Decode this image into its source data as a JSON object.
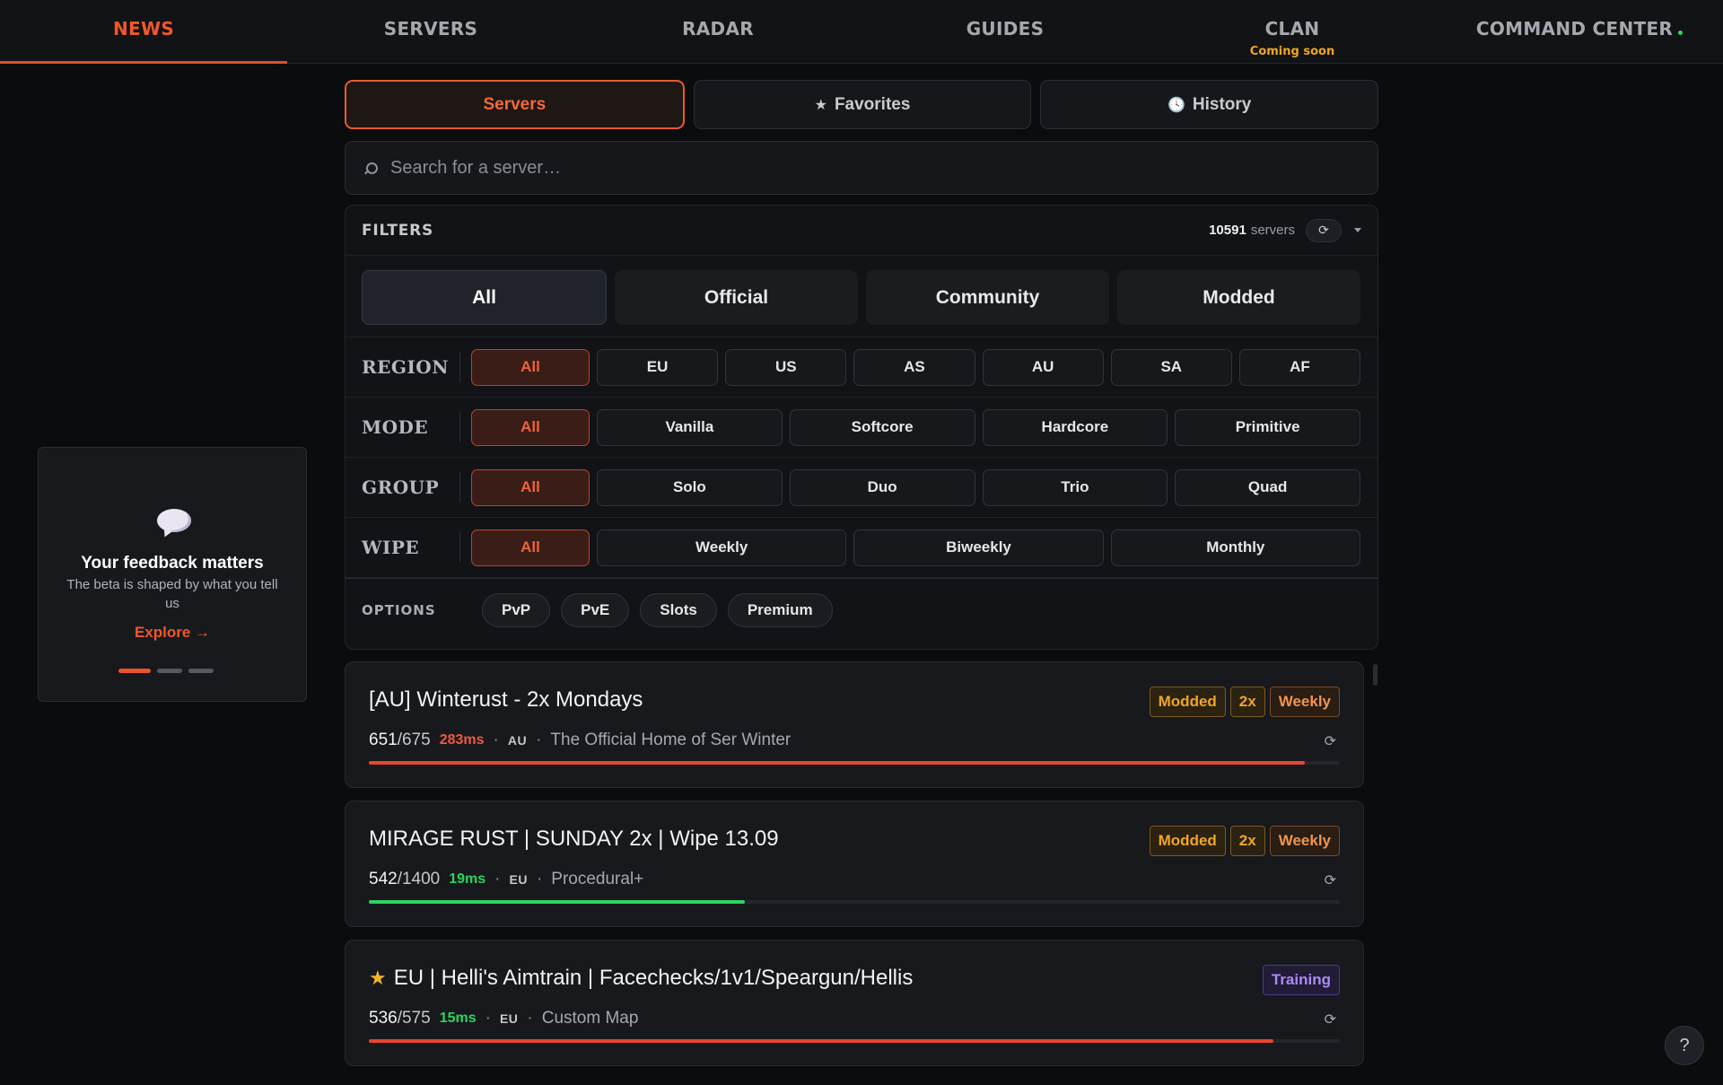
{
  "nav": {
    "items": [
      {
        "label": "NEWS",
        "sub": ""
      },
      {
        "label": "SERVERS",
        "sub": ""
      },
      {
        "label": "RADAR",
        "sub": ""
      },
      {
        "label": "GUIDES",
        "sub": ""
      },
      {
        "label": "CLAN",
        "sub": "Coming soon"
      },
      {
        "label": "COMMAND CENTER",
        "sub": ""
      }
    ],
    "active_index": 1,
    "accent_color": "#f2562b",
    "live_dot_color": "#2dd45e"
  },
  "tabs": [
    {
      "label": "Servers",
      "icon": ""
    },
    {
      "label": "Favorites",
      "icon": "star-icon"
    },
    {
      "label": "History",
      "icon": "clock-icon"
    }
  ],
  "search": {
    "placeholder": "Search for a server…",
    "value": ""
  },
  "filters": {
    "title": "FILTERS",
    "count": "10591",
    "count_unit": "servers",
    "types": [
      "All",
      "Official",
      "Community",
      "Modded"
    ],
    "rows": [
      {
        "label": "REGION",
        "options": [
          "All",
          "EU",
          "US",
          "AS",
          "AU",
          "SA",
          "AF"
        ]
      },
      {
        "label": "MODE",
        "options": [
          "All",
          "Vanilla",
          "Softcore",
          "Hardcore",
          "Primitive"
        ]
      },
      {
        "label": "GROUP",
        "options": [
          "All",
          "Solo",
          "Duo",
          "Trio",
          "Quad"
        ]
      },
      {
        "label": "WIPE",
        "options": [
          "All",
          "Weekly",
          "Biweekly",
          "Monthly"
        ]
      }
    ],
    "options_label": "OPTIONS",
    "options": [
      "PvP",
      "PvE",
      "Slots",
      "Premium"
    ]
  },
  "servers": [
    {
      "favorite": false,
      "name": "[AU] Winterust - 2x Mondays",
      "tags": [
        {
          "label": "Modded",
          "kind": "modded"
        },
        {
          "label": "2x",
          "kind": "multiplier"
        },
        {
          "label": "Weekly",
          "kind": "wipe"
        }
      ],
      "players": "651",
      "max": "/675",
      "ping": "283ms",
      "ping_quality": "bad",
      "region": "AU",
      "description": "The Official Home of Ser Winter",
      "fill_fraction": 0.964,
      "bar_color": "#e8452f"
    },
    {
      "favorite": false,
      "name": "MIRAGE RUST | SUNDAY 2x | Wipe 13.09",
      "tags": [
        {
          "label": "Modded",
          "kind": "modded"
        },
        {
          "label": "2x",
          "kind": "multiplier"
        },
        {
          "label": "Weekly",
          "kind": "wipe"
        }
      ],
      "players": "542",
      "max": "/1400",
      "ping": "19ms",
      "ping_quality": "good",
      "region": "EU",
      "description": "Procedural+",
      "fill_fraction": 0.387,
      "bar_color": "#2dd45e"
    },
    {
      "favorite": true,
      "name": "EU | Helli's Aimtrain | Facechecks/1v1/Speargun/Hellis",
      "tags": [
        {
          "label": "Training",
          "kind": "training"
        }
      ],
      "players": "536",
      "max": "/575",
      "ping": "15ms",
      "ping_quality": "good",
      "region": "EU",
      "description": "Custom Map",
      "fill_fraction": 0.932,
      "bar_color": "#e8452f"
    }
  ],
  "feedback": {
    "title": "Your feedback matters",
    "subtitle": "The beta is shaped by what you tell us",
    "link": "Explore →",
    "slides": 3,
    "active_slide": 0
  },
  "help": {
    "label": "?"
  }
}
